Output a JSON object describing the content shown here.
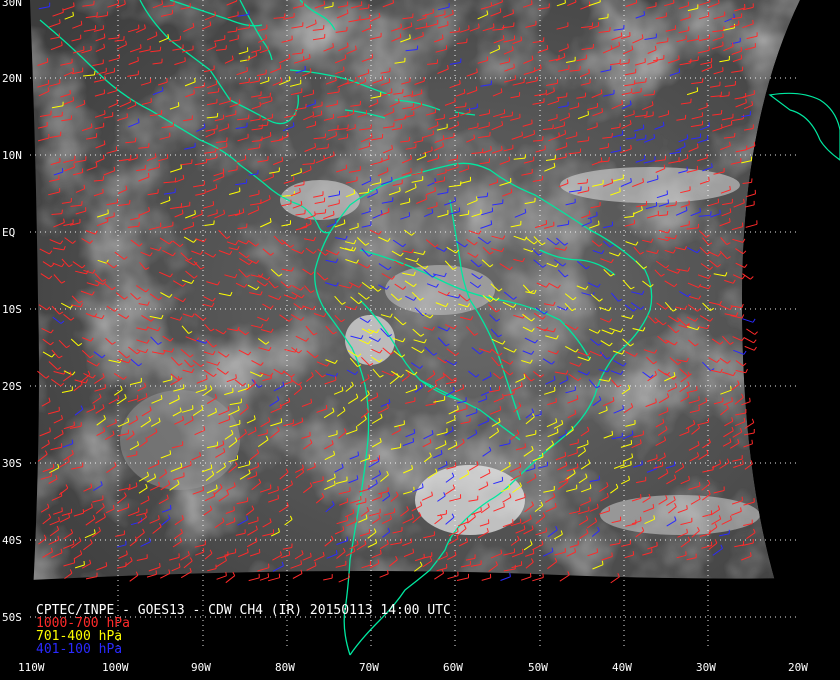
{
  "title": "CPTEC/INPE - GOES13 - CDW CH4 (IR) 20150113 14:00 UTC",
  "legend": [
    {
      "label": "1000-700 hPa",
      "color": "#ff2a2a"
    },
    {
      "label": "701-400 hPa",
      "color": "#ffff00"
    },
    {
      "label": "401-100 hPa",
      "color": "#2a2aff"
    }
  ],
  "colors": {
    "coastline": "#00e8a0",
    "grid": "#ffffff",
    "background": "#000000"
  },
  "lat_labels": [
    "30N",
    "20N",
    "10N",
    "EQ",
    "10S",
    "20S",
    "30S",
    "40S",
    "50S"
  ],
  "lon_labels": [
    "110W",
    "100W",
    "90W",
    "80W",
    "70W",
    "60W",
    "50W",
    "40W",
    "30W",
    "20W"
  ]
}
